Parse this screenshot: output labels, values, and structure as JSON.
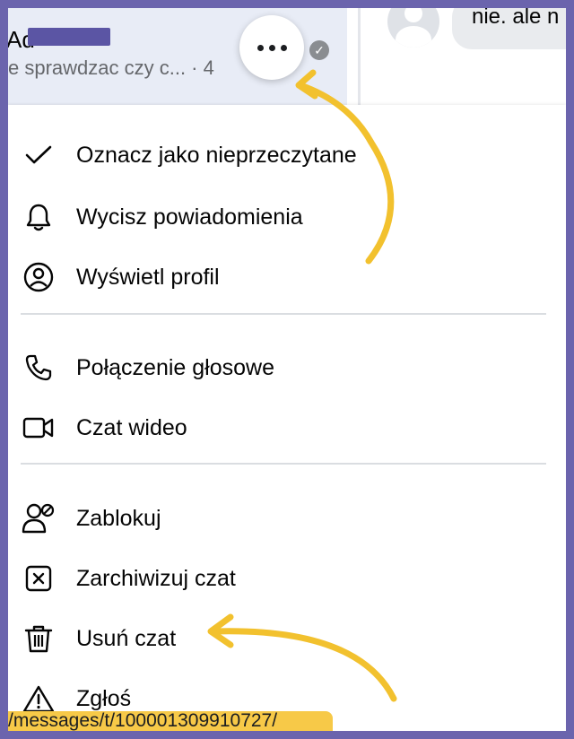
{
  "chat": {
    "name": "Ad",
    "preview": "e sprawdzac czy c... · 4",
    "more_icon": "ellipsis-icon",
    "read_icon": "check-circle-icon"
  },
  "conversation": {
    "bubble_text": "nie. ale n"
  },
  "menu": {
    "items": [
      {
        "label": "Oznacz jako nieprzeczytane",
        "icon": "check-icon"
      },
      {
        "label": "Wycisz powiadomienia",
        "icon": "bell-icon"
      },
      {
        "label": "Wyświetl profil",
        "icon": "user-circle-icon"
      },
      {
        "label": "Połączenie głosowe",
        "icon": "phone-icon"
      },
      {
        "label": "Czat wideo",
        "icon": "video-camera-icon"
      },
      {
        "label": "Zablokuj",
        "icon": "user-block-icon"
      },
      {
        "label": "Zarchiwizuj czat",
        "icon": "archive-x-icon"
      },
      {
        "label": "Usuń czat",
        "icon": "trash-icon"
      },
      {
        "label": "Zgłoś",
        "icon": "warning-icon"
      }
    ]
  },
  "status_bar": {
    "url": "/messages/t/100001309910727/"
  },
  "colors": {
    "frame": "#6b64ad",
    "annotation_arrow": "#f2c12e"
  }
}
